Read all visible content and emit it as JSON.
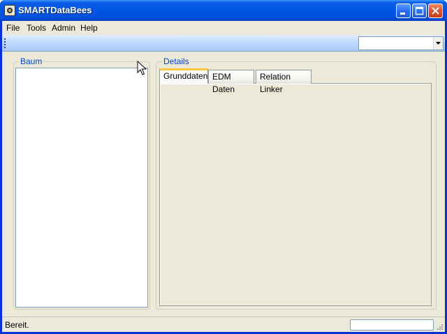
{
  "window": {
    "title": "SMARTDataBees"
  },
  "menu": {
    "items": [
      "File",
      "Tools",
      "Admin",
      "Help"
    ]
  },
  "toolbar": {
    "combo_value": ""
  },
  "tree_panel": {
    "legend": "Baum"
  },
  "details_panel": {
    "legend": "Details",
    "tabs": [
      "Grunddaten",
      "EDM Daten",
      "Relation Linker"
    ],
    "active_tab": "Grunddaten"
  },
  "status": {
    "text": "Bereit."
  },
  "colors": {
    "titlebar": "#0055e5",
    "client_bg": "#ece9d8",
    "legend_text": "#0046d5",
    "active_tab_accent": "#ffc83c",
    "toolstrip": "#c4dcff"
  },
  "icons": [
    "app-icon",
    "minimize-icon",
    "maximize-icon",
    "close-icon",
    "chevron-down-icon",
    "resize-grip-icon",
    "mouse-cursor-icon"
  ]
}
